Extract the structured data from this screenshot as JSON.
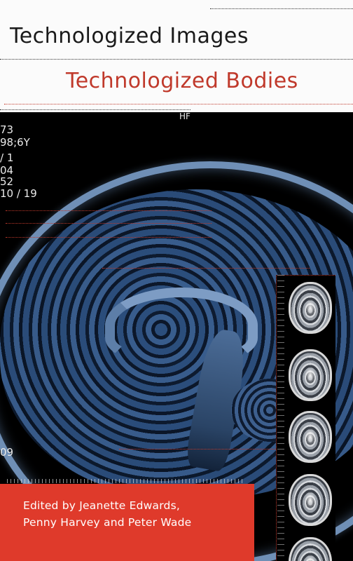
{
  "cover": {
    "title_line1": "Technologized Images",
    "title_line2": "Technologized Bodies",
    "editors_line1": "Edited by Jeanette Edwards,",
    "editors_line2": "Penny Harvey and Peter Wade"
  },
  "scan_labels": {
    "hf": "HF",
    "l1": "73",
    "l2": "98;6Y",
    "l3": "/ 1",
    "l4": "04",
    "l5": "52",
    "l6": "10 / 19",
    "l7": "09"
  },
  "colors": {
    "title_dark": "#1a1a1a",
    "title_accent": "#c0392b",
    "editors_band": "#df3a2b"
  }
}
